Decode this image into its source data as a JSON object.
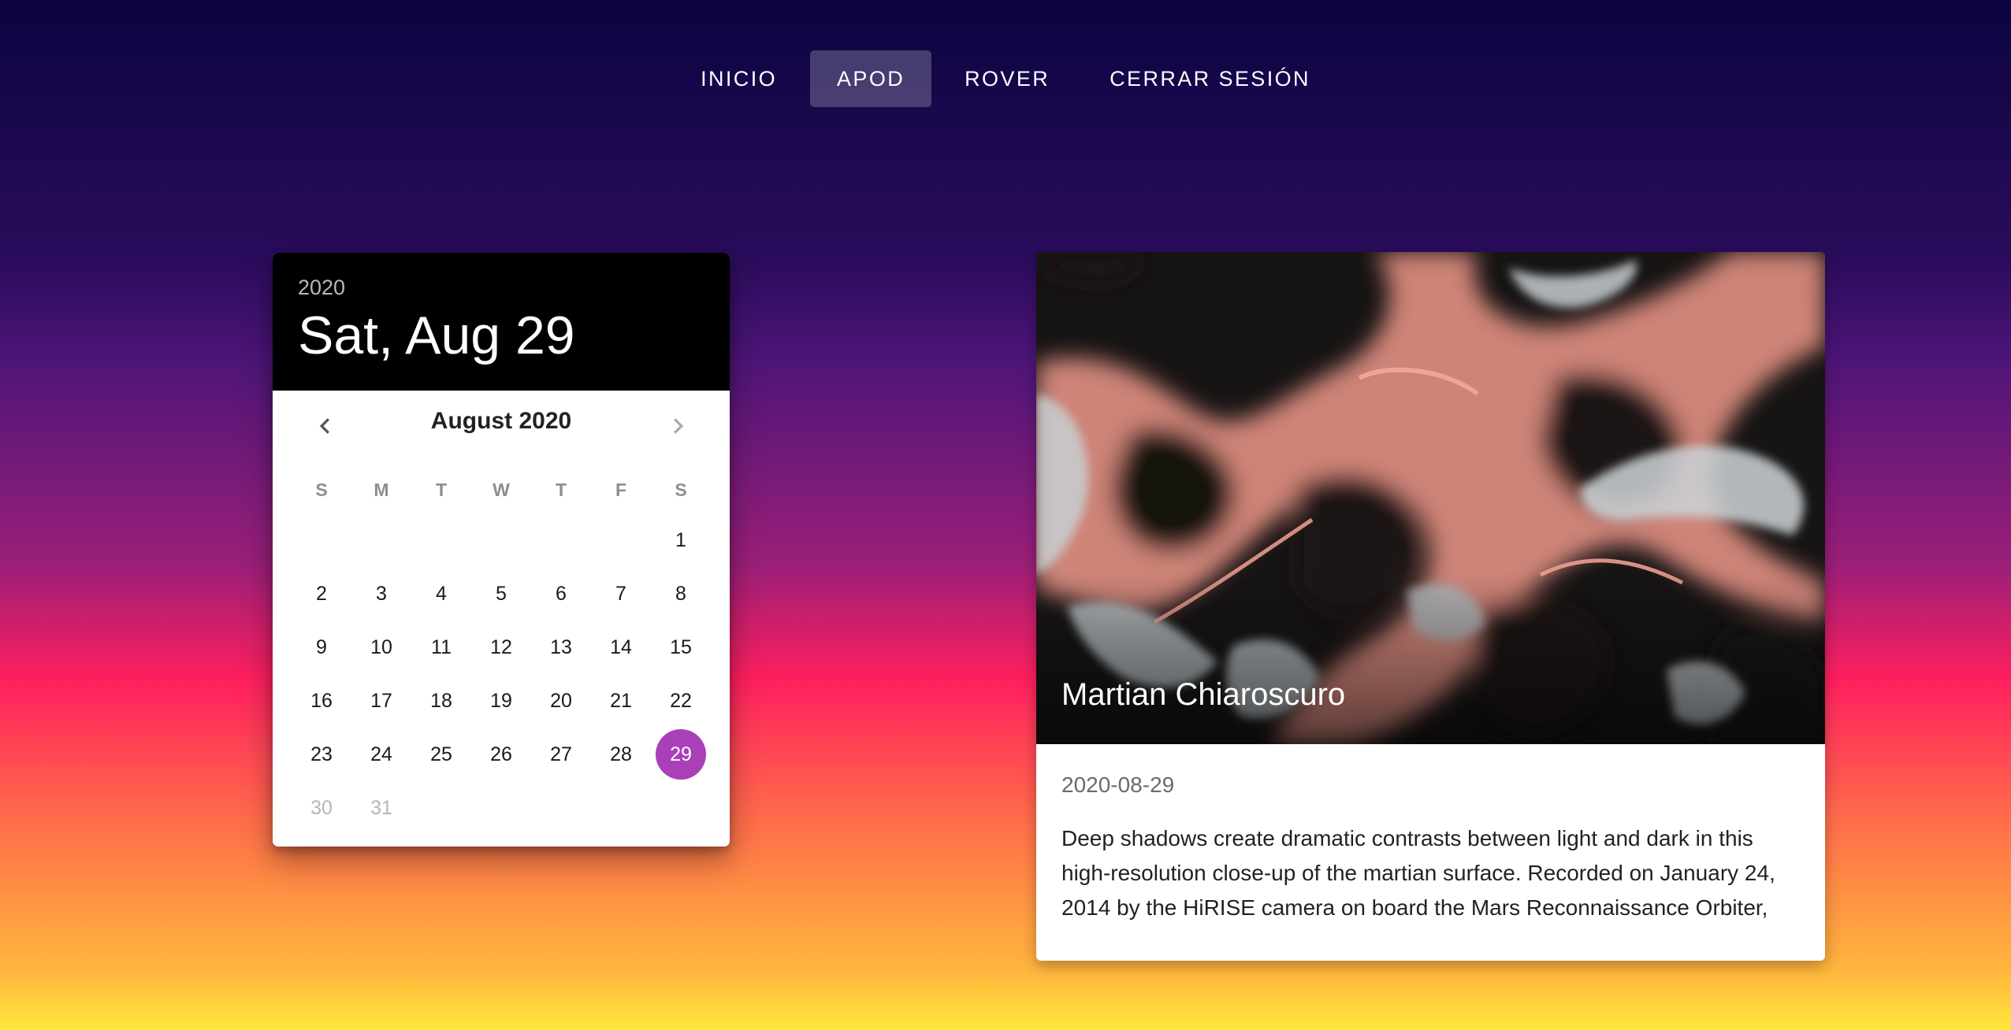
{
  "nav": {
    "items": [
      {
        "label": "INICIO"
      },
      {
        "label": "APOD"
      },
      {
        "label": "ROVER"
      },
      {
        "label": "CERRAR SESIÓN"
      }
    ],
    "active_index": 1
  },
  "picker": {
    "year": "2020",
    "selected_date_label": "Sat, Aug 29",
    "month_label": "August 2020",
    "weekdays": [
      "S",
      "M",
      "T",
      "W",
      "T",
      "F",
      "S"
    ],
    "weeks": [
      [
        "",
        "",
        "",
        "",
        "",
        "",
        "1"
      ],
      [
        "2",
        "3",
        "4",
        "5",
        "6",
        "7",
        "8"
      ],
      [
        "9",
        "10",
        "11",
        "12",
        "13",
        "14",
        "15"
      ],
      [
        "16",
        "17",
        "18",
        "19",
        "20",
        "21",
        "22"
      ],
      [
        "23",
        "24",
        "25",
        "26",
        "27",
        "28",
        "29"
      ],
      [
        "30",
        "31",
        "",
        "",
        "",
        "",
        ""
      ]
    ],
    "selected_day": "29",
    "disabled_days": [
      "30",
      "31"
    ],
    "accent_color": "#a940b8"
  },
  "apod": {
    "title": "Martian Chiaroscuro",
    "date": "2020-08-29",
    "explanation": "Deep shadows create dramatic contrasts between light and dark in this high-resolution close-up of the martian surface. Recorded on January 24, 2014 by the HiRISE camera on board the Mars Reconnaissance Orbiter,"
  }
}
